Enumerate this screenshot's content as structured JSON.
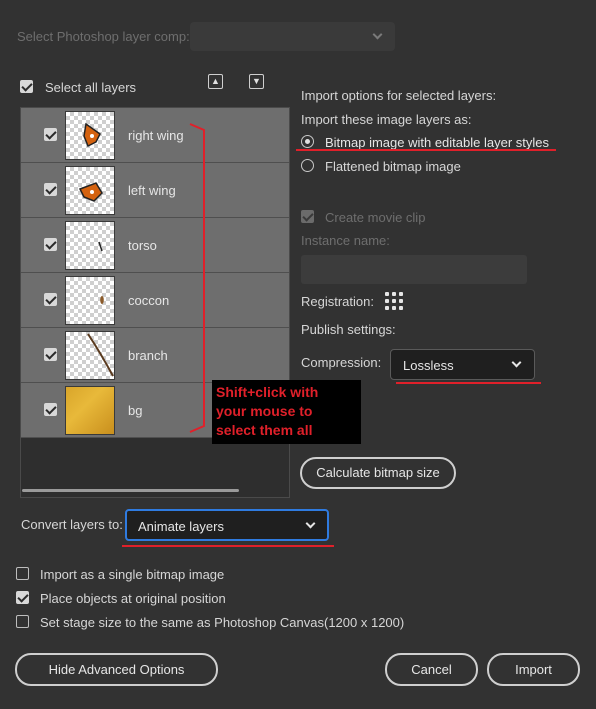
{
  "comp": {
    "label": "Select Photoshop layer comp:",
    "value": ""
  },
  "select_all": {
    "label": "Select all layers",
    "checked": true
  },
  "layers": [
    {
      "name": "right wing",
      "checked": true,
      "thumb": "butterfly-wing"
    },
    {
      "name": "left wing",
      "checked": true,
      "thumb": "butterfly-wing"
    },
    {
      "name": "torso",
      "checked": true,
      "thumb": "torso"
    },
    {
      "name": "coccon",
      "checked": true,
      "thumb": "cocoon"
    },
    {
      "name": "branch",
      "checked": true,
      "thumb": "branch"
    },
    {
      "name": "bg",
      "checked": true,
      "thumb": "yellow-background"
    }
  ],
  "annotation": [
    "Shift+click with",
    "your mouse to",
    "select them all"
  ],
  "options": {
    "heading": "Import options for selected layers:",
    "import_as_label": "Import these image layers as:",
    "radio_bitmap": "Bitmap image with editable layer styles",
    "radio_flattened": "Flattened bitmap image",
    "create_movie_clip": "Create movie clip",
    "instance_name_label": "Instance name:",
    "instance_name_value": "",
    "registration_label": "Registration:",
    "publish_label": "Publish settings:",
    "compression_label": "Compression:",
    "compression_value": "Lossless",
    "calc_button": "Calculate bitmap size"
  },
  "convert": {
    "label": "Convert layers to:",
    "value": "Animate layers"
  },
  "bottom_checks": [
    {
      "label": "Import as a single bitmap image",
      "checked": false
    },
    {
      "label": "Place objects at original position",
      "checked": true
    },
    {
      "label": "Set stage size to the same as Photoshop Canvas(1200 x 1200)",
      "checked": false
    }
  ],
  "buttons": {
    "advanced": "Hide Advanced Options",
    "cancel": "Cancel",
    "import": "Import"
  },
  "colors": {
    "accent": "#2f7be0",
    "annotation_red": "#e0202a",
    "background": "#323232"
  }
}
